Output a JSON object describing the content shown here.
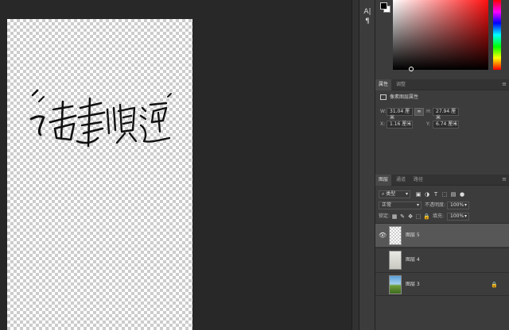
{
  "mini_dock": {
    "text_tool": "A|",
    "para_tool": "¶"
  },
  "color": {
    "foreground": "#000000",
    "background": "#ffffff"
  },
  "properties": {
    "tabs": [
      "属性",
      "调整"
    ],
    "heading": "像素图层属性",
    "w_label": "W:",
    "w_value": "31.04 厘米",
    "h_label": "H:",
    "h_value": "27.94 厘米",
    "x_label": "X:",
    "x_value": "1.16 厘米",
    "y_label": "Y:",
    "y_value": "6.74 厘米"
  },
  "layers_panel": {
    "tabs": [
      "图层",
      "通道",
      "路径"
    ],
    "filter_kind": "类型",
    "blend_mode": "正常",
    "opacity_label": "不透明度:",
    "opacity_value": "100%",
    "lock_label": "锁定:",
    "fill_label": "填充:",
    "fill_value": "100%",
    "layers": [
      {
        "name": "图层 5",
        "visible": true,
        "selected": true,
        "locked": false
      },
      {
        "name": "图层 4",
        "visible": false,
        "selected": false,
        "locked": false
      },
      {
        "name": "图层 3",
        "visible": false,
        "selected": false,
        "locked": true
      }
    ]
  }
}
